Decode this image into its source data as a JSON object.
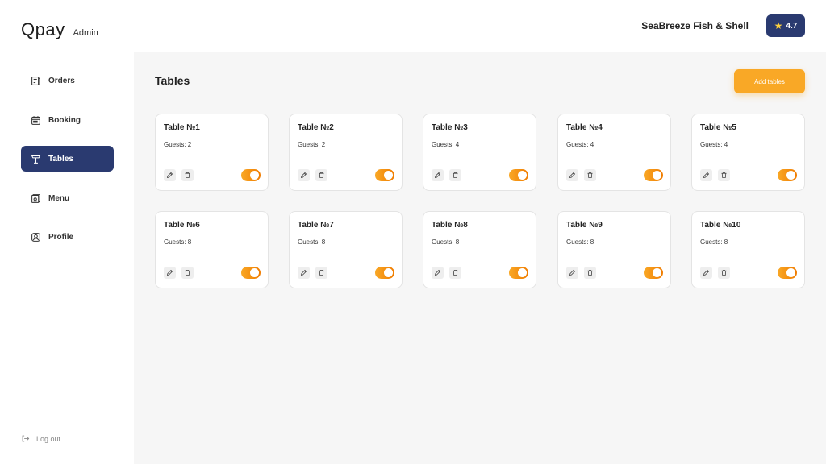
{
  "brand": {
    "logo": "Qpay",
    "subtitle": "Admin"
  },
  "header": {
    "restaurant_name": "SeaBreeze Fish & Shell",
    "rating": "4.7"
  },
  "sidebar": {
    "items": [
      {
        "label": "Orders",
        "icon": "orders-icon"
      },
      {
        "label": "Booking",
        "icon": "calendar-icon"
      },
      {
        "label": "Tables",
        "icon": "table-icon"
      },
      {
        "label": "Menu",
        "icon": "menu-book-icon"
      },
      {
        "label": "Profile",
        "icon": "profile-icon"
      }
    ],
    "active": "Tables",
    "logout_label": "Log out"
  },
  "main": {
    "title": "Tables",
    "add_button_label": "Add tables",
    "tables": [
      {
        "name": "Table №1",
        "guests": "Guests: 2",
        "enabled": true
      },
      {
        "name": "Table №2",
        "guests": "Guests: 2",
        "enabled": true
      },
      {
        "name": "Table №3",
        "guests": "Guests: 4",
        "enabled": true
      },
      {
        "name": "Table №4",
        "guests": "Guests: 4",
        "enabled": true
      },
      {
        "name": "Table №5",
        "guests": "Guests: 4",
        "enabled": true
      },
      {
        "name": "Table №6",
        "guests": "Guests: 8",
        "enabled": true
      },
      {
        "name": "Table №7",
        "guests": "Guests: 8",
        "enabled": true
      },
      {
        "name": "Table №8",
        "guests": "Guests: 8",
        "enabled": true
      },
      {
        "name": "Table №9",
        "guests": "Guests: 8",
        "enabled": true
      },
      {
        "name": "Table №10",
        "guests": "Guests: 8",
        "enabled": true
      }
    ]
  },
  "colors": {
    "primary": "#2a3a70",
    "accent": "#f9a826",
    "background": "#f6f6f6",
    "star": "#ffd23f"
  }
}
